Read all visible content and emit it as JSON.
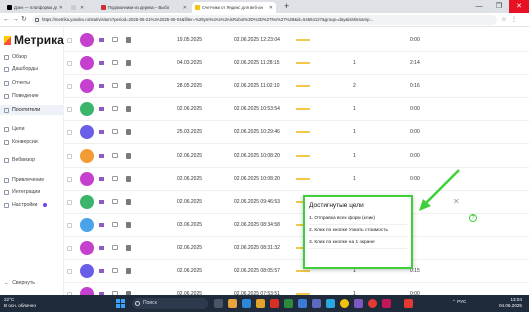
{
  "browser": {
    "tabs": [
      {
        "title": "Дзен — платформа для просмо",
        "favicon_color": "#000000",
        "active": false
      },
      {
        "title": "Подоконники из дерева – Выбо",
        "favicon_color": "#d22f2f",
        "active": false
      },
      {
        "title": "Счетчики от Яндекс для веб-ан",
        "favicon_color": "#f4c20d",
        "active": true
      },
      {
        "title": "",
        "favicon_color": "#cccccc",
        "active": false
      }
    ],
    "new_tab": "+",
    "window_controls": [
      "—",
      "❐",
      "✕"
    ],
    "url": "https://metrika.yandex.ru/stat/visitors?period=2025-05-21%3A2025-06-04&filter=%28ym%3As%3AisRobot%3D%3D%27No%27%29&id=54564127&group=day&isMinSamp..."
  },
  "sidebar": {
    "logo": "Метрика",
    "items": [
      {
        "label": "Обзор",
        "active": false
      },
      {
        "label": "Дашборды",
        "active": false
      },
      {
        "label": "Отчеты",
        "active": false
      },
      {
        "label": "Поведение",
        "active": false
      },
      {
        "label": "Посетители",
        "active": true
      },
      {
        "label": "Цели",
        "active": false
      },
      {
        "label": "Конверсии",
        "active": false
      },
      {
        "label": "Вебвизор",
        "active": false
      },
      {
        "label": "Привлечение",
        "active": false
      },
      {
        "label": "Интеграции",
        "active": false
      },
      {
        "label": "Настройки",
        "active": false
      }
    ],
    "collapse": "Свернуть"
  },
  "table": {
    "rows": [
      {
        "avatar_color": "#c640cf",
        "first_visit": "19.05.2025",
        "last_visit": "02.06.2025 12:23:04",
        "visits": "",
        "time": "0:00"
      },
      {
        "avatar_color": "#c640cf",
        "first_visit": "04.03.2025",
        "last_visit": "02.06.2025 11:28:15",
        "visits": "1",
        "time": "2:14"
      },
      {
        "avatar_color": "#c640cf",
        "first_visit": "28.05.2025",
        "last_visit": "02.06.2025 11:02:10",
        "visits": "2",
        "time": "0:16"
      },
      {
        "avatar_color": "#3bb56b",
        "first_visit": "02.06.2025",
        "last_visit": "02.06.2025 10:53:54",
        "visits": "1",
        "time": "0:00"
      },
      {
        "avatar_color": "#6a5ee8",
        "first_visit": "25.03.2025",
        "last_visit": "02.06.2025 10:29:46",
        "visits": "1",
        "time": "0:00"
      },
      {
        "avatar_color": "#f39c35",
        "first_visit": "02.06.2025",
        "last_visit": "02.06.2025 10:08:20",
        "visits": "1",
        "time": "0:00"
      },
      {
        "avatar_color": "#c640cf",
        "first_visit": "02.06.2025",
        "last_visit": "02.06.2025 10:08:20",
        "visits": "1",
        "time": "0:00"
      },
      {
        "avatar_color": "#3bb56b",
        "first_visit": "02.06.2025",
        "last_visit": "02.06.2025 09:46:53",
        "visits": "",
        "time": ""
      },
      {
        "avatar_color": "#4aa3e8",
        "first_visit": "03.06.2025",
        "last_visit": "02.06.2025 08:34:58",
        "visits": "",
        "time": ""
      },
      {
        "avatar_color": "#c640cf",
        "first_visit": "02.06.2025",
        "last_visit": "02.06.2025 08:31:32",
        "visits": "",
        "time": ""
      },
      {
        "avatar_color": "#6a5ee8",
        "first_visit": "02.06.2025",
        "last_visit": "02.06.2025 08:05:57",
        "visits": "1",
        "time": "0:15"
      },
      {
        "avatar_color": "#c640cf",
        "first_visit": "02.06.2025",
        "last_visit": "02.06.2025 07:53:51",
        "visits": "1",
        "time": "0:00"
      }
    ]
  },
  "goals_popup": {
    "title": "Достигнутые цели",
    "goals": [
      "1. Отправка всех форм (клик)",
      "2. Клик по кнопке Узнать стоимость",
      "3. Клик по кнопке на 1 экране"
    ],
    "close": "✕",
    "help": "?",
    "highlight_color": "#3fcf3a"
  },
  "taskbar": {
    "weather_temp": "22°C",
    "weather_text": "В осн. облачно",
    "search_placeholder": "Поиск",
    "lang": "РУС",
    "time": "13:04",
    "date": "04.06.2025"
  }
}
